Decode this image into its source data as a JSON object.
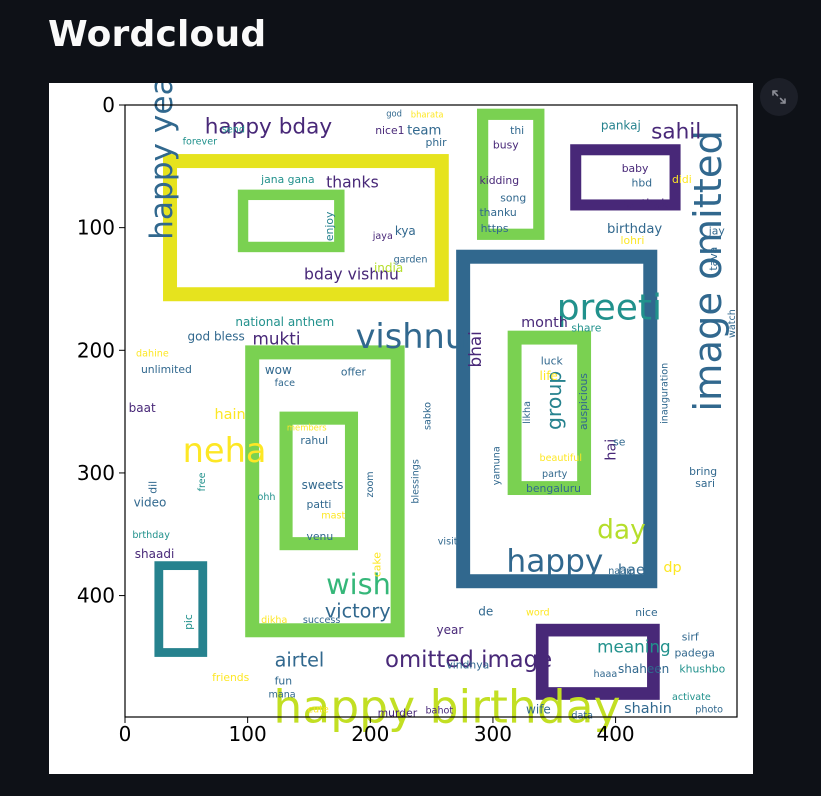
{
  "page": {
    "title": "Wordcloud"
  },
  "toolbar": {
    "expand_icon": "fullscreen-expand-icon"
  },
  "chart_data": {
    "type": "wordcloud",
    "x_ticks": [
      "0",
      "100",
      "200",
      "300",
      "400"
    ],
    "y_ticks": [
      "0",
      "100",
      "200",
      "300",
      "400"
    ],
    "xlim": [
      0,
      499
    ],
    "ylim": [
      499,
      0
    ],
    "grid": false,
    "frames": [
      {
        "x0": 31,
        "y0": 40,
        "x1": 264,
        "y1": 160,
        "color": "#e6e31e"
      },
      {
        "x0": 92,
        "y0": 69,
        "x1": 179,
        "y1": 120,
        "color": "#7ad151"
      },
      {
        "x0": 287,
        "y0": 3,
        "x1": 342,
        "y1": 110,
        "color": "#7ad151"
      },
      {
        "x0": 363,
        "y0": 32,
        "x1": 453,
        "y1": 86,
        "color": "#482878"
      },
      {
        "x0": 270,
        "y0": 118,
        "x1": 434,
        "y1": 394,
        "color": "#31688e"
      },
      {
        "x0": 312,
        "y0": 184,
        "x1": 380,
        "y1": 318,
        "color": "#7ad151"
      },
      {
        "x0": 98,
        "y0": 196,
        "x1": 228,
        "y1": 434,
        "color": "#7ad151"
      },
      {
        "x0": 126,
        "y0": 250,
        "x1": 190,
        "y1": 363,
        "color": "#7ad151"
      },
      {
        "x0": 24,
        "y0": 372,
        "x1": 67,
        "y1": 450,
        "color": "#26828e"
      },
      {
        "x0": 335,
        "y0": 423,
        "x1": 436,
        "y1": 485,
        "color": "#482878"
      }
    ],
    "words": [
      {
        "text": "happy birthday",
        "x": 121,
        "y": 476,
        "size": 38,
        "color": "#c2df23"
      },
      {
        "text": "image omitted",
        "x": 463,
        "y": 250,
        "size": 32,
        "color": "#31688e",
        "rotate": -90
      },
      {
        "text": "preeti",
        "x": 352,
        "y": 154,
        "size": 30,
        "color": "#21918c"
      },
      {
        "text": "vishnu",
        "x": 188,
        "y": 178,
        "size": 28,
        "color": "#31688e"
      },
      {
        "text": "happy year",
        "x": 20,
        "y": 110,
        "size": 26,
        "color": "#31688e",
        "rotate": -90
      },
      {
        "text": "neha",
        "x": 47,
        "y": 271,
        "size": 28,
        "color": "#fde725"
      },
      {
        "text": "happy",
        "x": 311,
        "y": 362,
        "size": 26,
        "color": "#31688e"
      },
      {
        "text": "wish",
        "x": 164,
        "y": 381,
        "size": 24,
        "color": "#35b779"
      },
      {
        "text": "day",
        "x": 385,
        "y": 338,
        "size": 22,
        "color": "#b5de2b"
      },
      {
        "text": "omitted image",
        "x": 212,
        "y": 445,
        "size": 19,
        "color": "#482878"
      },
      {
        "text": "happy bday",
        "x": 65,
        "y": 11,
        "size": 18,
        "color": "#482878"
      },
      {
        "text": "sahil",
        "x": 429,
        "y": 15,
        "size": 18,
        "color": "#482878"
      },
      {
        "text": "group",
        "x": 343,
        "y": 265,
        "size": 17,
        "color": "#26828e",
        "rotate": -90
      },
      {
        "text": "victory",
        "x": 163,
        "y": 406,
        "size": 16,
        "color": "#31688e"
      },
      {
        "text": "airtel",
        "x": 122,
        "y": 446,
        "size": 16,
        "color": "#31688e"
      },
      {
        "text": "mukti",
        "x": 104,
        "y": 185,
        "size": 14,
        "color": "#482878"
      },
      {
        "text": "bday vishnu",
        "x": 146,
        "y": 133,
        "size": 13,
        "color": "#482878"
      },
      {
        "text": "thanks",
        "x": 164,
        "y": 58,
        "size": 13,
        "color": "#482878"
      },
      {
        "text": "meaning",
        "x": 385,
        "y": 436,
        "size": 14,
        "color": "#21918c"
      },
      {
        "text": "bhai",
        "x": 280,
        "y": 214,
        "size": 14,
        "color": "#482878",
        "rotate": -90
      },
      {
        "text": "month",
        "x": 323,
        "y": 173,
        "size": 12,
        "color": "#482878"
      },
      {
        "text": "hain",
        "x": 73,
        "y": 248,
        "size": 12,
        "color": "#fde725"
      },
      {
        "text": "team",
        "x": 230,
        "y": 17,
        "size": 11,
        "color": "#31688e"
      },
      {
        "text": "national anthem",
        "x": 90,
        "y": 173,
        "size": 10,
        "color": "#21918c"
      },
      {
        "text": "god bless",
        "x": 51,
        "y": 185,
        "size": 10,
        "color": "#31688e"
      },
      {
        "text": "birthday",
        "x": 393,
        "y": 97,
        "size": 11,
        "color": "#31688e"
      },
      {
        "text": "sarthak",
        "x": 406,
        "y": 77,
        "size": 10,
        "color": "#482878"
      },
      {
        "text": "pankaj",
        "x": 388,
        "y": 13,
        "size": 10,
        "color": "#26828e"
      },
      {
        "text": "hae",
        "x": 402,
        "y": 375,
        "size": 12,
        "color": "#31688e"
      },
      {
        "text": "hai",
        "x": 392,
        "y": 290,
        "size": 12,
        "color": "#482878",
        "rotate": -90
      },
      {
        "text": "dp",
        "x": 439,
        "y": 373,
        "size": 12,
        "color": "#fde725"
      },
      {
        "text": "shahin",
        "x": 407,
        "y": 488,
        "size": 12,
        "color": "#31688e"
      },
      {
        "text": "shaheen",
        "x": 402,
        "y": 456,
        "size": 10,
        "color": "#31688e"
      },
      {
        "text": "india",
        "x": 203,
        "y": 129,
        "size": 10,
        "color": "#b5de2b"
      },
      {
        "text": "kya",
        "x": 220,
        "y": 99,
        "size": 10,
        "color": "#31688e"
      },
      {
        "text": "enjoy",
        "x": 163,
        "y": 111,
        "size": 9,
        "color": "#26828e",
        "rotate": -90
      },
      {
        "text": "jana gana",
        "x": 111,
        "y": 57,
        "size": 9,
        "color": "#21918c"
      },
      {
        "text": "garden",
        "x": 219,
        "y": 123,
        "size": 8,
        "color": "#31688e"
      },
      {
        "text": "jaya",
        "x": 202,
        "y": 104,
        "size": 8,
        "color": "#482878"
      },
      {
        "text": "busy",
        "x": 300,
        "y": 29,
        "size": 9,
        "color": "#482878"
      },
      {
        "text": "kidding",
        "x": 289,
        "y": 58,
        "size": 9,
        "color": "#482878"
      },
      {
        "text": "song",
        "x": 306,
        "y": 72,
        "size": 9,
        "color": "#31688e"
      },
      {
        "text": "thanku",
        "x": 289,
        "y": 84,
        "size": 9,
        "color": "#31688e"
      },
      {
        "text": "https",
        "x": 290,
        "y": 97,
        "size": 9,
        "color": "#31688e"
      },
      {
        "text": "thi",
        "x": 314,
        "y": 17,
        "size": 9,
        "color": "#31688e"
      },
      {
        "text": "baby",
        "x": 405,
        "y": 48,
        "size": 9,
        "color": "#482878"
      },
      {
        "text": "hbd",
        "x": 413,
        "y": 60,
        "size": 9,
        "color": "#31688e"
      },
      {
        "text": "didi",
        "x": 446,
        "y": 57,
        "size": 9,
        "color": "#fde725"
      },
      {
        "text": "lohri",
        "x": 404,
        "y": 107,
        "size": 9,
        "color": "#fde725"
      },
      {
        "text": "jay",
        "x": 476,
        "y": 99,
        "size": 9,
        "color": "#31688e"
      },
      {
        "text": "tava",
        "x": 476,
        "y": 135,
        "size": 9,
        "color": "#31688e",
        "rotate": -90
      },
      {
        "text": "share",
        "x": 364,
        "y": 178,
        "size": 9,
        "color": "#21918c"
      },
      {
        "text": "luck",
        "x": 339,
        "y": 205,
        "size": 9,
        "color": "#31688e"
      },
      {
        "text": "life",
        "x": 338,
        "y": 217,
        "size": 10,
        "color": "#fde725"
      },
      {
        "text": "likha",
        "x": 325,
        "y": 260,
        "size": 8,
        "color": "#31688e",
        "rotate": -90
      },
      {
        "text": "auspicious",
        "x": 370,
        "y": 265,
        "size": 9,
        "color": "#31688e",
        "rotate": -90
      },
      {
        "text": "beautiful",
        "x": 338,
        "y": 285,
        "size": 8,
        "color": "#fde725"
      },
      {
        "text": "party",
        "x": 340,
        "y": 298,
        "size": 8,
        "color": "#31688e"
      },
      {
        "text": "bengaluru",
        "x": 327,
        "y": 309,
        "size": 9,
        "color": "#31688e"
      },
      {
        "text": "yamuna",
        "x": 300,
        "y": 310,
        "size": 8,
        "color": "#31688e",
        "rotate": -90
      },
      {
        "text": "inauguration",
        "x": 437,
        "y": 260,
        "size": 8,
        "color": "#31688e",
        "rotate": -90
      },
      {
        "text": "watch",
        "x": 492,
        "y": 190,
        "size": 8,
        "color": "#31688e",
        "rotate": -90
      },
      {
        "text": "bring",
        "x": 460,
        "y": 295,
        "size": 9,
        "color": "#31688e"
      },
      {
        "text": "sari",
        "x": 465,
        "y": 305,
        "size": 9,
        "color": "#31688e"
      },
      {
        "text": "se",
        "x": 398,
        "y": 271,
        "size": 9,
        "color": "#31688e"
      },
      {
        "text": "naam",
        "x": 394,
        "y": 377,
        "size": 8,
        "color": "#31688e"
      },
      {
        "text": "nice",
        "x": 416,
        "y": 410,
        "size": 9,
        "color": "#31688e"
      },
      {
        "text": "sirf",
        "x": 454,
        "y": 430,
        "size": 9,
        "color": "#31688e"
      },
      {
        "text": "padega",
        "x": 448,
        "y": 443,
        "size": 9,
        "color": "#31688e"
      },
      {
        "text": "khushbo",
        "x": 452,
        "y": 456,
        "size": 9,
        "color": "#21918c"
      },
      {
        "text": "activate",
        "x": 446,
        "y": 480,
        "size": 8,
        "color": "#21918c"
      },
      {
        "text": "photo",
        "x": 465,
        "y": 490,
        "size": 8,
        "color": "#31688e"
      },
      {
        "text": "haaa",
        "x": 382,
        "y": 461,
        "size": 8,
        "color": "#31688e"
      },
      {
        "text": "wife",
        "x": 327,
        "y": 489,
        "size": 10,
        "color": "#31688e"
      },
      {
        "text": "data",
        "x": 364,
        "y": 495,
        "size": 8,
        "color": "#31688e"
      },
      {
        "text": "word",
        "x": 327,
        "y": 411,
        "size": 8,
        "color": "#fde725"
      },
      {
        "text": "de",
        "x": 288,
        "y": 409,
        "size": 10,
        "color": "#31688e"
      },
      {
        "text": "year",
        "x": 254,
        "y": 424,
        "size": 10,
        "color": "#482878"
      },
      {
        "text": "vindhya",
        "x": 262,
        "y": 453,
        "size": 9,
        "color": "#31688e"
      },
      {
        "text": "bahot",
        "x": 245,
        "y": 491,
        "size": 8,
        "color": "#482878"
      },
      {
        "text": "murder",
        "x": 206,
        "y": 492,
        "size": 9,
        "color": "#482878"
      },
      {
        "text": "cute",
        "x": 149,
        "y": 490,
        "size": 8,
        "color": "#fde725"
      },
      {
        "text": "fun",
        "x": 122,
        "y": 466,
        "size": 9,
        "color": "#31688e"
      },
      {
        "text": "mana",
        "x": 117,
        "y": 478,
        "size": 8,
        "color": "#31688e"
      },
      {
        "text": "friends",
        "x": 71,
        "y": 463,
        "size": 9,
        "color": "#fde725"
      },
      {
        "text": "success",
        "x": 145,
        "y": 417,
        "size": 8,
        "color": "#31688e"
      },
      {
        "text": "dikha",
        "x": 111,
        "y": 417,
        "size": 8,
        "color": "#fde725"
      },
      {
        "text": "cake",
        "x": 202,
        "y": 385,
        "size": 9,
        "color": "#fde725",
        "rotate": -90
      },
      {
        "text": "zoom",
        "x": 197,
        "y": 320,
        "size": 8,
        "color": "#31688e",
        "rotate": -90
      },
      {
        "text": "blessings",
        "x": 234,
        "y": 325,
        "size": 8,
        "color": "#31688e",
        "rotate": -90
      },
      {
        "text": "sabko",
        "x": 244,
        "y": 265,
        "size": 8,
        "color": "#31688e",
        "rotate": -90
      },
      {
        "text": "visit",
        "x": 255,
        "y": 353,
        "size": 8,
        "color": "#31688e"
      },
      {
        "text": "offer",
        "x": 176,
        "y": 214,
        "size": 9,
        "color": "#31688e"
      },
      {
        "text": "face",
        "x": 122,
        "y": 224,
        "size": 8,
        "color": "#31688e"
      },
      {
        "text": "wow",
        "x": 114,
        "y": 212,
        "size": 10,
        "color": "#31688e"
      },
      {
        "text": "members",
        "x": 132,
        "y": 260,
        "size": 7,
        "color": "#fde725"
      },
      {
        "text": "rahul",
        "x": 143,
        "y": 270,
        "size": 9,
        "color": "#31688e"
      },
      {
        "text": "sweets",
        "x": 144,
        "y": 306,
        "size": 10,
        "color": "#31688e"
      },
      {
        "text": "patti",
        "x": 148,
        "y": 322,
        "size": 9,
        "color": "#31688e"
      },
      {
        "text": "mast",
        "x": 160,
        "y": 332,
        "size": 8,
        "color": "#fde725"
      },
      {
        "text": "venu",
        "x": 148,
        "y": 348,
        "size": 9,
        "color": "#31688e"
      },
      {
        "text": "ohh",
        "x": 108,
        "y": 317,
        "size": 8,
        "color": "#21918c"
      },
      {
        "text": "free",
        "x": 60,
        "y": 315,
        "size": 8,
        "color": "#21918c",
        "rotate": -90
      },
      {
        "text": "dil",
        "x": 19,
        "y": 317,
        "size": 9,
        "color": "#31688e",
        "rotate": -90
      },
      {
        "text": "video",
        "x": 7,
        "y": 320,
        "size": 10,
        "color": "#31688e"
      },
      {
        "text": "brthday",
        "x": 6,
        "y": 348,
        "size": 8,
        "color": "#21918c"
      },
      {
        "text": "shaadi",
        "x": 8,
        "y": 362,
        "size": 10,
        "color": "#482878"
      },
      {
        "text": "baat",
        "x": 3,
        "y": 243,
        "size": 10,
        "color": "#482878"
      },
      {
        "text": "unlimited",
        "x": 13,
        "y": 212,
        "size": 9,
        "color": "#31688e"
      },
      {
        "text": "dahine",
        "x": 9,
        "y": 200,
        "size": 8,
        "color": "#fde725"
      },
      {
        "text": "pic",
        "x": 48,
        "y": 428,
        "size": 9,
        "color": "#21918c",
        "rotate": -90
      },
      {
        "text": "forever",
        "x": 47,
        "y": 27,
        "size": 8,
        "color": "#21918c"
      },
      {
        "text": "send",
        "x": 79,
        "y": 17,
        "size": 8,
        "color": "#21918c"
      },
      {
        "text": "nice1",
        "x": 204,
        "y": 17,
        "size": 9,
        "color": "#482878"
      },
      {
        "text": "phir",
        "x": 245,
        "y": 27,
        "size": 9,
        "color": "#31688e"
      },
      {
        "text": "god",
        "x": 213,
        "y": 4,
        "size": 7,
        "color": "#31688e"
      },
      {
        "text": "bharata",
        "x": 233,
        "y": 5,
        "size": 7,
        "color": "#fde725"
      }
    ]
  }
}
